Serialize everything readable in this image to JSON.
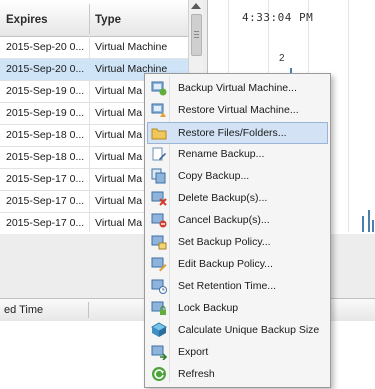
{
  "table": {
    "headers": {
      "expires": "Expires",
      "type": "Type"
    },
    "rows": [
      {
        "expires": "2015-Sep-20 0...",
        "type": "Virtual Machine"
      },
      {
        "expires": "2015-Sep-20 0...",
        "type": "Virtual Machine"
      },
      {
        "expires": "2015-Sep-19 0...",
        "type": "Virtual Ma"
      },
      {
        "expires": "2015-Sep-19 0...",
        "type": "Virtual Ma"
      },
      {
        "expires": "2015-Sep-18 0...",
        "type": "Virtual Ma"
      },
      {
        "expires": "2015-Sep-18 0...",
        "type": "Virtual Ma"
      },
      {
        "expires": "2015-Sep-17 0...",
        "type": "Virtual Ma"
      },
      {
        "expires": "2015-Sep-17 0...",
        "type": "Virtual Ma"
      },
      {
        "expires": "2015-Sep-17 0...",
        "type": "Virtual Ma"
      }
    ],
    "selected_row": 1
  },
  "chart": {
    "clock": "4:33:04 PM",
    "y_tick": "2"
  },
  "lower_table": {
    "headers": {
      "time": "ed Time"
    }
  },
  "context_menu": {
    "items": [
      {
        "label": "Backup Virtual Machine...",
        "icon": "backup-vm-icon"
      },
      {
        "label": "Restore Virtual Machine...",
        "icon": "restore-vm-icon"
      },
      {
        "label": "Restore Files/Folders...",
        "icon": "folder-icon"
      },
      {
        "label": "Rename Backup...",
        "icon": "rename-icon"
      },
      {
        "label": "Copy Backup...",
        "icon": "copy-icon"
      },
      {
        "label": "Delete Backup(s)...",
        "icon": "delete-icon"
      },
      {
        "label": "Cancel Backup(s)...",
        "icon": "cancel-icon"
      },
      {
        "label": "Set Backup Policy...",
        "icon": "set-policy-icon"
      },
      {
        "label": "Edit Backup Policy...",
        "icon": "edit-policy-icon"
      },
      {
        "label": "Set Retention Time...",
        "icon": "retention-icon"
      },
      {
        "label": "Lock Backup",
        "icon": "lock-icon"
      },
      {
        "label": "Calculate Unique Backup Size",
        "icon": "calculate-icon"
      },
      {
        "label": "Export",
        "icon": "export-icon"
      },
      {
        "label": "Refresh",
        "icon": "refresh-icon"
      }
    ],
    "highlighted_index": 2
  },
  "colors": {
    "selection": "#cfe4f7",
    "menu_highlight": "#d3e3f5",
    "chart_bars": "#4a7fae"
  }
}
